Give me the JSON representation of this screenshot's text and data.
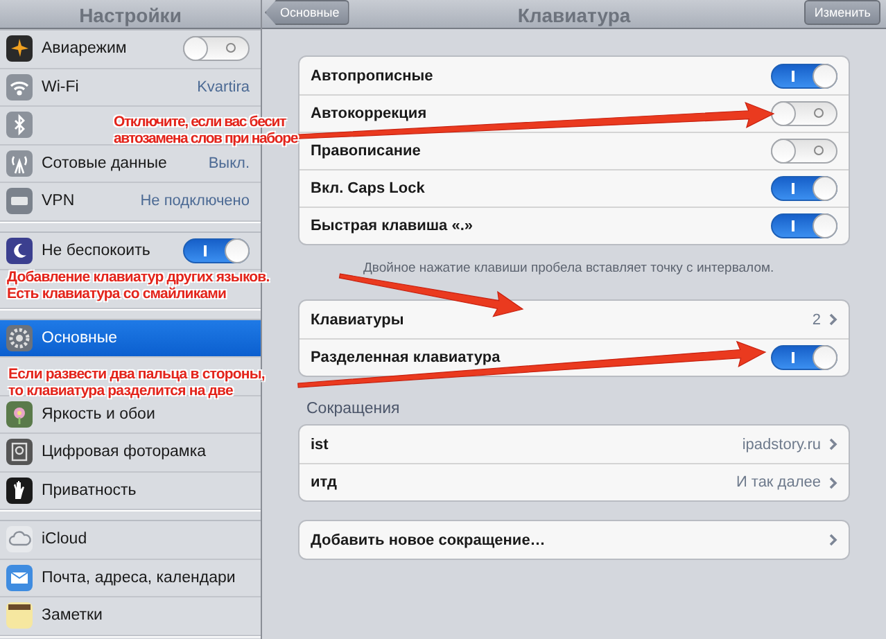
{
  "sidebar": {
    "title": "Настройки",
    "groups": [
      [
        {
          "label": "Авиарежим",
          "kind": "toggle",
          "on": false,
          "selected": false
        },
        {
          "label": "Wi-Fi",
          "kind": "value",
          "value": "Kvartira",
          "selected": false
        },
        {
          "kind": "covered",
          "selected": false
        },
        {
          "label": "Сотовые данные",
          "kind": "value",
          "value": "Выкл.",
          "selected": false
        },
        {
          "label": "VPN",
          "kind": "value",
          "value": "Не подключено",
          "selected": false
        }
      ],
      [
        {
          "label": "Не беспокоить",
          "kind": "toggle",
          "on": true,
          "selected": false
        },
        {
          "kind": "covered",
          "selected": false
        }
      ],
      [
        {
          "label": "Основные",
          "kind": "plain",
          "selected": true
        },
        {
          "kind": "covered",
          "selected": false
        },
        {
          "label": "Яркость и обои",
          "kind": "plain",
          "selected": false
        },
        {
          "label": "Цифровая фоторамка",
          "kind": "plain",
          "selected": false
        },
        {
          "label": "Приватность",
          "kind": "plain",
          "selected": false
        }
      ],
      [
        {
          "label": "iCloud",
          "kind": "plain",
          "selected": false
        },
        {
          "label": "Почта, адреса, календари",
          "kind": "plain",
          "selected": false
        },
        {
          "label": "Заметки",
          "kind": "plain",
          "selected": false
        }
      ]
    ]
  },
  "navbar": {
    "back": "Основные",
    "title": "Клавиатура",
    "action": "Изменить"
  },
  "sections": [
    {
      "rows": [
        {
          "label": "Автопрописные",
          "kind": "toggle",
          "on": true
        },
        {
          "label": "Автокоррекция",
          "kind": "toggle",
          "on": false
        },
        {
          "label": "Правописание",
          "kind": "toggle",
          "on": false
        },
        {
          "label": "Вкл. Caps Lock",
          "kind": "toggle",
          "on": true
        },
        {
          "label": "Быстрая клавиша «.»",
          "kind": "toggle",
          "on": true
        }
      ],
      "footer": "Двойное нажатие клавиши пробела вставляет точку с интервалом."
    },
    {
      "rows": [
        {
          "label": "Клавиатуры",
          "kind": "link",
          "value": "2"
        },
        {
          "label": "Разделенная клавиатура",
          "kind": "toggle",
          "on": true
        }
      ]
    },
    {
      "header": "Сокращения",
      "rows": [
        {
          "label": "ist",
          "kind": "link",
          "value": "ipadstory.ru"
        },
        {
          "label": "итд",
          "kind": "link",
          "value": "И так далее"
        }
      ]
    },
    {
      "rows": [
        {
          "label": "Добавить новое сокращение…",
          "kind": "link"
        }
      ]
    }
  ],
  "callouts": [
    {
      "lines": [
        "Отключите, если вас бесит",
        "автозамена слов при наборе"
      ]
    },
    {
      "lines": [
        "Добавление клавиатур других языков.",
        "Есть клавиатура со смайликами"
      ]
    },
    {
      "lines": [
        "Если развести два пальца в стороны,",
        "то клавиатура разделится на две"
      ]
    }
  ]
}
